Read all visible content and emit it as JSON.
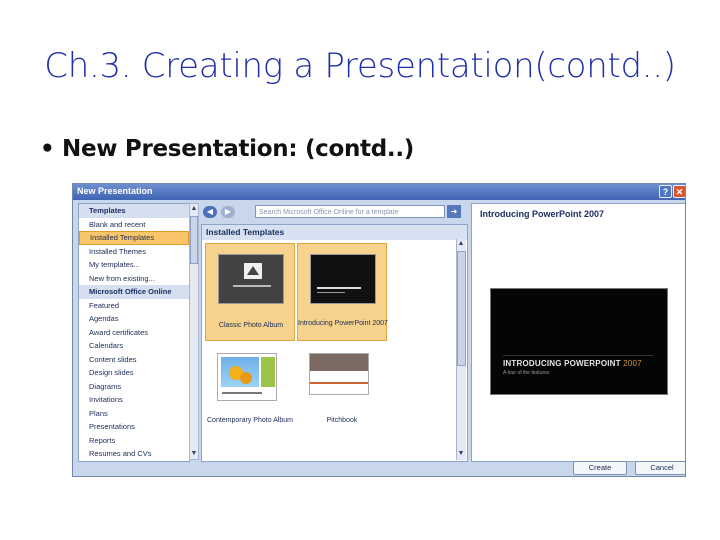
{
  "slide": {
    "title": "Ch.3. Creating a Presentation(contd..)",
    "bullet_symbol": "•",
    "bullet": "New Presentation: (contd..)"
  },
  "dialog": {
    "title": "New Presentation",
    "help_label": "?",
    "close_label": "✕",
    "search_placeholder": "Search Microsoft Office Online for a template",
    "left_nav": [
      {
        "label": "Templates",
        "kind": "header"
      },
      {
        "label": "Blank and recent",
        "kind": "item"
      },
      {
        "label": "Installed Templates",
        "kind": "selected"
      },
      {
        "label": "Installed Themes",
        "kind": "item"
      },
      {
        "label": "My templates...",
        "kind": "item"
      },
      {
        "label": "New from existing...",
        "kind": "item"
      },
      {
        "label": "Microsoft Office Online",
        "kind": "header"
      },
      {
        "label": "Featured",
        "kind": "item"
      },
      {
        "label": "Agendas",
        "kind": "item"
      },
      {
        "label": "Award certificates",
        "kind": "item"
      },
      {
        "label": "Calendars",
        "kind": "item"
      },
      {
        "label": "Content slides",
        "kind": "item"
      },
      {
        "label": "Design slides",
        "kind": "item"
      },
      {
        "label": "Diagrams",
        "kind": "item"
      },
      {
        "label": "Invitations",
        "kind": "item"
      },
      {
        "label": "Plans",
        "kind": "item"
      },
      {
        "label": "Presentations",
        "kind": "item"
      },
      {
        "label": "Reports",
        "kind": "item"
      },
      {
        "label": "Resumes and CVs",
        "kind": "item"
      }
    ],
    "section_header": "Installed Templates",
    "templates": [
      {
        "label": "Classic Photo Album",
        "selected": true
      },
      {
        "label": "Introducing PowerPoint 2007",
        "selected": true
      },
      {
        "label": "Contemporary Photo Album",
        "selected": false
      },
      {
        "label": "Pitchbook",
        "selected": false
      }
    ],
    "preview": {
      "title": "Introducing PowerPoint 2007",
      "slide_text_main": "INTRODUCING POWERPOINT ",
      "slide_text_year": "2007",
      "slide_subtitle": "A tour of the features"
    },
    "create_label": "Create",
    "cancel_label": "Cancel"
  }
}
